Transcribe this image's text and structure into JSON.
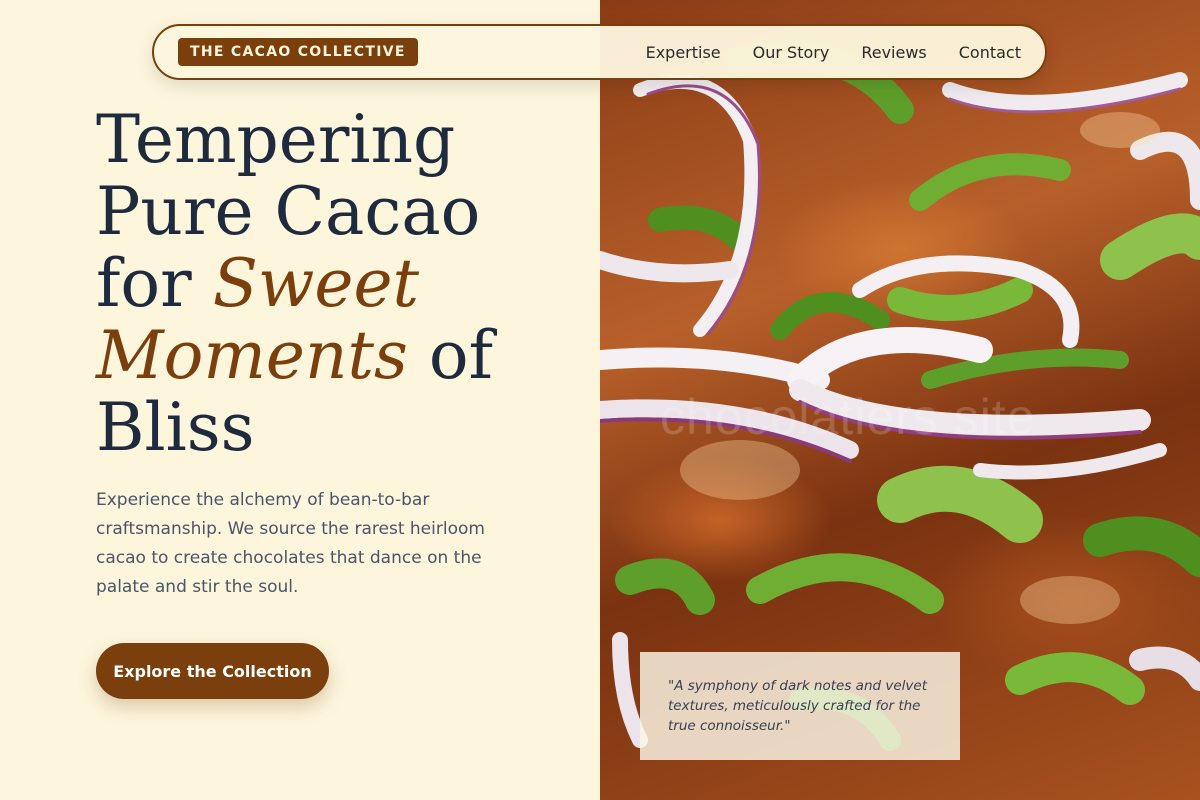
{
  "brand": {
    "name": "THE CACAO COLLECTIVE"
  },
  "nav": {
    "links": [
      "Expertise",
      "Our Story",
      "Reviews",
      "Contact"
    ]
  },
  "hero": {
    "title_line1": "Tempering",
    "title_line2": "Pure Cacao",
    "title_for": "for ",
    "title_accent1": "Sweet",
    "title_accent2": "Moments",
    "title_of": " of",
    "title_line5": "Bliss",
    "description": "Experience the alchemy of bean-to-bar craftsmanship. We source the rarest heirloom cacao to create chocolates that dance on the palate and stir the soul.",
    "cta_label": "Explore the Collection"
  },
  "quote": {
    "text": "\"A symphony of dark notes and velvet textures, meticulously crafted for the true connoisseur.\""
  },
  "watermark": "chocolatiers site",
  "colors": {
    "background": "#fdf6dd",
    "accent": "#7a3f0c",
    "heading": "#1e2a3e",
    "body_text": "#4a5568"
  }
}
